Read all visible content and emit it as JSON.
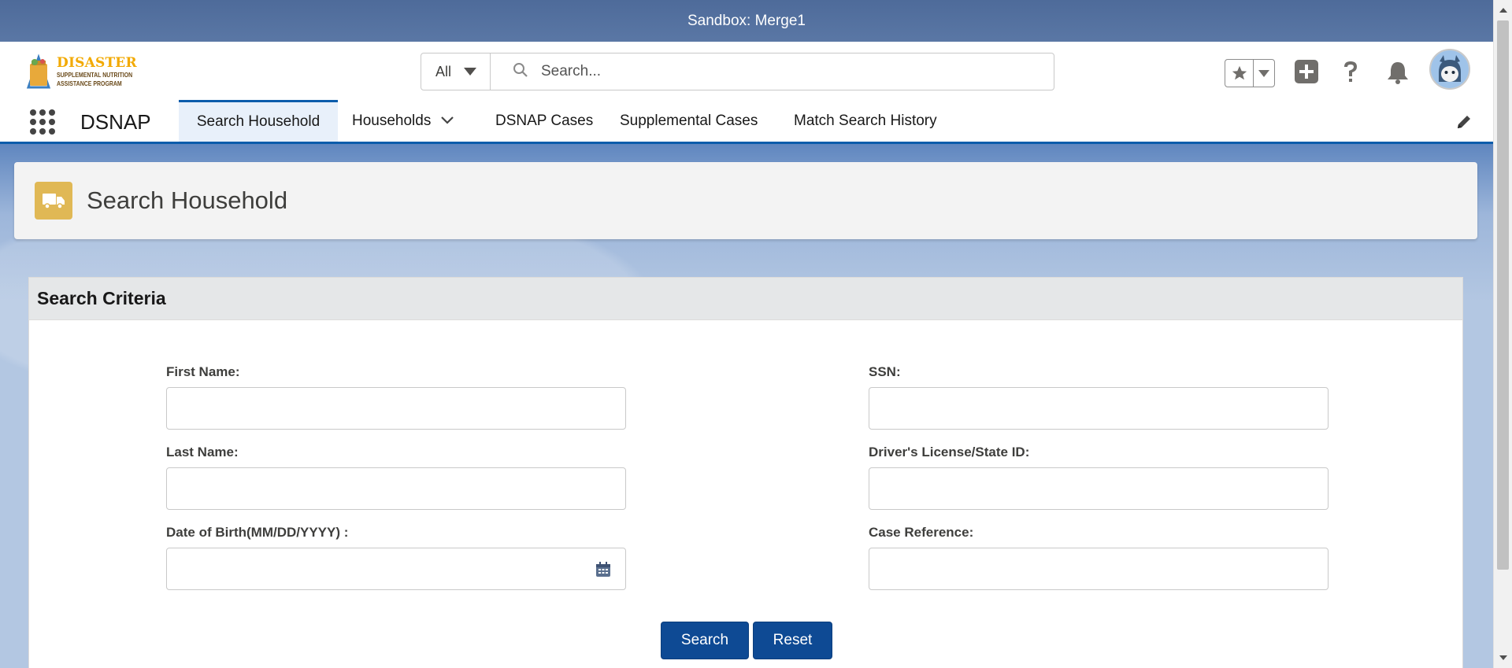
{
  "sandbox": {
    "label": "Sandbox: Merge1"
  },
  "logo": {
    "title": "DISASTER",
    "line1": "SUPPLEMENTAL NUTRITION",
    "line2": "ASSISTANCE PROGRAM"
  },
  "search": {
    "scope": "All",
    "placeholder": "Search..."
  },
  "app": {
    "name": "DSNAP"
  },
  "nav": {
    "tabs": [
      {
        "label": "Search Household",
        "active": true
      },
      {
        "label": "Households",
        "has_menu": true
      },
      {
        "label": "DSNAP Cases"
      },
      {
        "label": "Supplemental Cases"
      },
      {
        "label": "Match Search History"
      }
    ]
  },
  "page": {
    "title": "Search Household"
  },
  "form": {
    "section_title": "Search Criteria",
    "first_name": {
      "label": "First Name:",
      "value": ""
    },
    "last_name": {
      "label": "Last Name:",
      "value": ""
    },
    "dob": {
      "label": "Date of Birth(MM/DD/YYYY) :",
      "value": ""
    },
    "ssn": {
      "label": "SSN:",
      "value": ""
    },
    "license": {
      "label": "Driver's License/State ID:",
      "value": ""
    },
    "case_ref": {
      "label": "Case Reference:",
      "value": ""
    },
    "search_button": "Search",
    "reset_button": "Reset"
  },
  "colors": {
    "brand": "#0b5cab",
    "button": "#0e4a94",
    "header_icon": "#e0b855"
  }
}
